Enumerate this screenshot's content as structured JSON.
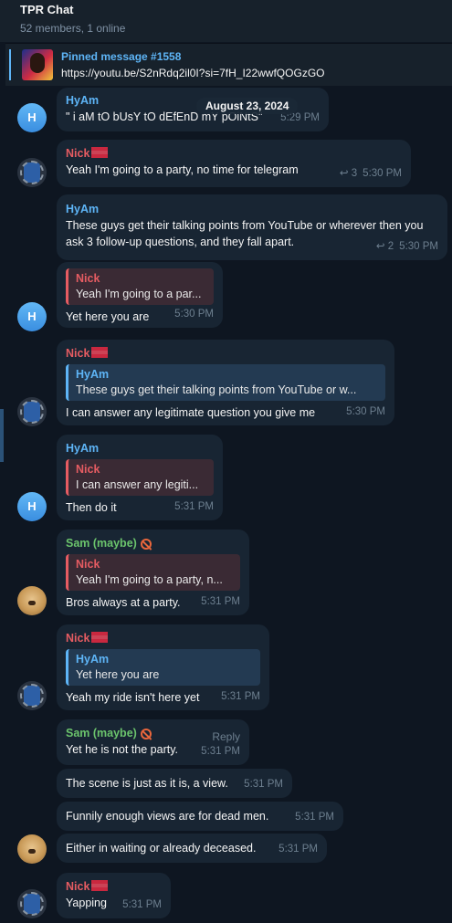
{
  "header": {
    "title": "TPR Chat",
    "subtitle": "52 members, 1 online"
  },
  "pinned": {
    "title": "Pinned message #1558",
    "text": "https://youtu.be/S2nRdq2il0I?si=7fH_I22wwfQOGzGO"
  },
  "date_separator": "August 23, 2024",
  "messages": [
    {
      "sender": "HyAm",
      "avatar": "H",
      "text": "\" i aM tO bUsY tO dEfEnD mY pOiNtS\"",
      "time": "5:29 PM"
    },
    {
      "sender": "Nick",
      "text": "Yeah I'm going to a party, no time for telegram",
      "replies": "3",
      "time": "5:30 PM"
    },
    {
      "sender": "HyAm",
      "text": "These guys get their talking points from YouTube or wherever then you ask 3 follow-up questions, and they fall apart.",
      "replies": "2",
      "time": "5:30 PM"
    },
    {
      "quote_name": "Nick",
      "quote_text": "Yeah I'm going to a par...",
      "text": "Yet here you are",
      "avatar": "H",
      "time": "5:30 PM"
    },
    {
      "sender": "Nick",
      "quote_name": "HyAm",
      "quote_text": "These guys get their talking points from YouTube or w...",
      "text": "I can answer any legitimate question you give me",
      "time": "5:30 PM"
    },
    {
      "sender": "HyAm",
      "quote_name": "Nick",
      "quote_text": "I can answer any legiti...",
      "text": "Then do it",
      "avatar": "H",
      "time": "5:31 PM"
    },
    {
      "sender": "Sam (maybe)",
      "quote_name": "Nick",
      "quote_text": "Yeah I'm going to a party, n...",
      "text": "Bros always at a party.",
      "time": "5:31 PM"
    },
    {
      "sender": "Nick",
      "quote_name": "HyAm",
      "quote_text": "Yet here you are",
      "text": "Yeah my ride isn't here yet",
      "time": "5:31 PM"
    },
    {
      "sender": "Sam (maybe)",
      "reply_label": "Reply",
      "text": "Yet he is not the party.",
      "time": "5:31 PM"
    },
    {
      "text": "The scene is just as it is, a view.",
      "time": "5:31 PM"
    },
    {
      "text": "Funnily enough views are for dead men.",
      "time": "5:31 PM"
    },
    {
      "text": "Either in waiting or already deceased.",
      "time": "5:31 PM"
    },
    {
      "sender": "Nick",
      "text": "Yapping",
      "time": "5:31 PM"
    }
  ],
  "colors": {
    "background": "#0e1621",
    "bubble": "#182533",
    "accent": "#5eb5f7",
    "nick": "#e65c62",
    "sam": "#6bc46c"
  },
  "icons": [
    "reply-arrow-icon",
    "flag-icon",
    "no-entry-icon"
  ]
}
